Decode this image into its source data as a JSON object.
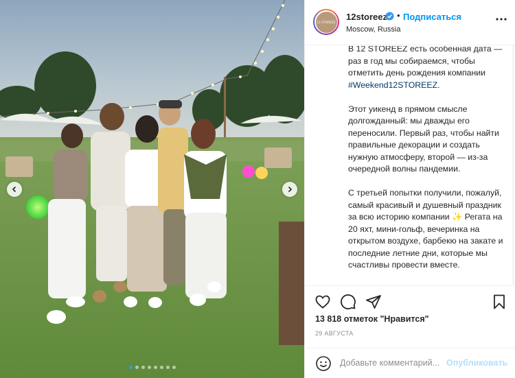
{
  "post": {
    "username": "12storeez",
    "separator": "•",
    "follow_label": "Подписаться",
    "location": "Moscow, Russia",
    "avatar_text": "12 STOREEZ",
    "more_icon": "more-options-icon",
    "verified_icon": "verified-badge-icon",
    "verified_color": "#3897f0"
  },
  "caption": {
    "p1_text": "В 12 STOREEZ есть особенная дата — раз в год мы собираемся, чтобы отметить день рождения компании ",
    "p1_hashtag": "#Weekend12STOREEZ",
    "p1_end": ".",
    "p2": "Этот уикенд в прямом смысле долгожданный: мы дважды его переносили. Первый раз, чтобы найти правильные декорации и создать нужную атмосферу, второй — из-за очередной волны пандемии.",
    "p3_text": "С третьей попытки получили, пожалуй, самый красивый и душевный праздник за всю историю компании ",
    "p3_emoji": "✨",
    "p3_end": " Регата на 20 яхт, мини-гольф, вечеринка на открытом воздухе, барбекю на закате и последние летние дни, которые мы счастливы провести вместе."
  },
  "actions": {
    "like_icon": "heart-icon",
    "comment_icon": "comment-icon",
    "share_icon": "paper-plane-icon",
    "save_icon": "bookmark-icon"
  },
  "stats": {
    "likes_text": "13 818 отметок \"Нравится\"",
    "date": "29 АВГУСТА"
  },
  "comment": {
    "emoji_icon": "smiley-icon",
    "placeholder": "Добавьте комментарий...",
    "publish_label": "Опубликовать"
  },
  "carousel": {
    "prev_icon": "chevron-left-icon",
    "next_icon": "chevron-right-icon",
    "dot_count": 8,
    "active_index": 0
  },
  "colors": {
    "accent": "#0095f6",
    "hashtag": "#00376b",
    "text": "#262626",
    "muted": "#8e8e8e",
    "publish_disabled": "#b2dffc"
  }
}
